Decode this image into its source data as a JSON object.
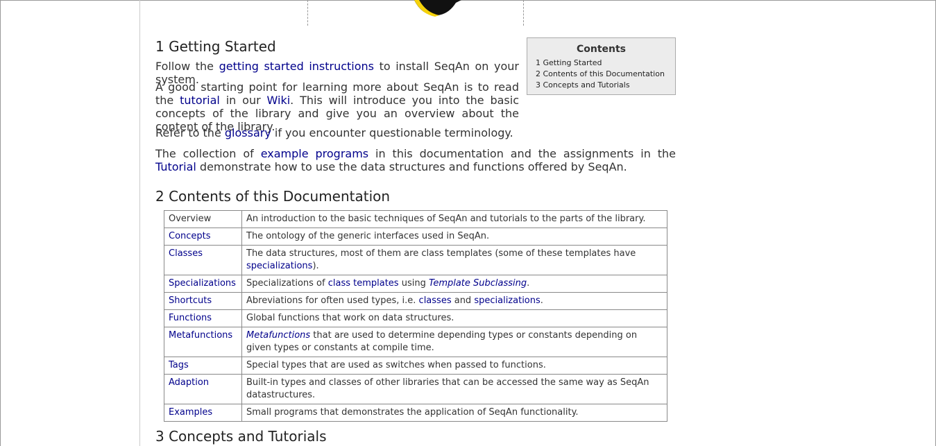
{
  "toc": {
    "title": "Contents",
    "items": [
      "1 Getting Started",
      "2 Contents of this Documentation",
      "3 Concepts and Tutorials"
    ]
  },
  "sections": {
    "s1": {
      "heading": "1 Getting Started"
    },
    "s2": {
      "heading": "2 Contents of this Documentation"
    },
    "s3": {
      "heading": "3 Concepts and Tutorials"
    }
  },
  "para1": {
    "t1": "Follow the ",
    "link": "getting started instructions",
    "t2": " to install SeqAn on your system."
  },
  "para2": {
    "t1": "A good starting point for learning more about SeqAn is to read the ",
    "link1": "tutorial",
    "t2": " in our ",
    "link2": "Wiki",
    "t3": ". This will introduce you into the basic concepts of the library and give you an overview about the content of the library."
  },
  "para3": {
    "t1": "Refer to the ",
    "link": "glossary",
    "t2": " if you encounter questionable terminology."
  },
  "para4": {
    "t1": "The collection of ",
    "link1": "example programs",
    "t2": " in this documentation and the assignments in the ",
    "link2": "Tutorial",
    "t3": " demonstrate how to use the data structures and functions offered by SeqAn."
  },
  "table": {
    "overview": {
      "name": "Overview",
      "desc": "An introduction to the basic techniques of SeqAn and tutorials to the parts of the library."
    },
    "concepts": {
      "name": "Concepts",
      "desc": "The ontology of the generic interfaces used in SeqAn."
    },
    "classes": {
      "name": "Classes",
      "d1": "The data structures, most of them are class templates (some of these templates have ",
      "link": "specializations",
      "d2": ")."
    },
    "specializations": {
      "name": "Specializations",
      "d1": "Specializations of ",
      "link1": "class templates",
      "d2": " using ",
      "link2": "Template Subclassing",
      "d3": "."
    },
    "shortcuts": {
      "name": "Shortcuts",
      "d1": "Abreviations for often used types, i.e. ",
      "link1": "classes",
      "d2": " and ",
      "link2": "specializations",
      "d3": "."
    },
    "functions": {
      "name": "Functions",
      "desc": "Global functions that work on data structures."
    },
    "metafunctions": {
      "name": "Metafunctions",
      "link": "Metafunctions",
      "d1": " that are used to determine depending types or constants depending on given types or constants at compile time."
    },
    "tags": {
      "name": "Tags",
      "desc": "Special types that are used as switches when passed to functions."
    },
    "adaption": {
      "name": "Adaption",
      "desc": "Built-in types and classes of other libraries that can be accessed the same way as SeqAn datastructures."
    },
    "examples": {
      "name": "Examples",
      "desc": "Small programs that demonstrates the application of SeqAn functionality."
    }
  },
  "colors": {
    "link": "#00008b",
    "toc_bg": "#ececec",
    "logo_yellow": "#f5d20a",
    "logo_black": "#111111"
  },
  "icons": {
    "logo": "seqan-logo-icon"
  }
}
